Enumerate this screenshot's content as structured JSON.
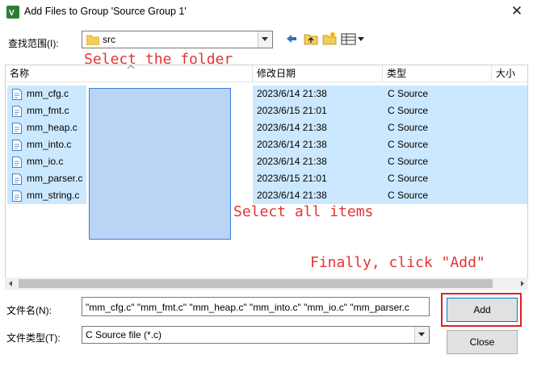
{
  "window": {
    "title": "Add Files to Group 'Source Group 1'"
  },
  "lookin": {
    "label": "查找范围(I):",
    "value": "src"
  },
  "columns": [
    {
      "label": "名称"
    },
    {
      "label": "修改日期"
    },
    {
      "label": "类型"
    },
    {
      "label": "大小"
    }
  ],
  "files": [
    {
      "name": "mm_cfg.c",
      "modified": "2023/6/14 21:38",
      "type": "C Source"
    },
    {
      "name": "mm_fmt.c",
      "modified": "2023/6/15 21:01",
      "type": "C Source"
    },
    {
      "name": "mm_heap.c",
      "modified": "2023/6/14 21:38",
      "type": "C Source"
    },
    {
      "name": "mm_into.c",
      "modified": "2023/6/14 21:38",
      "type": "C Source"
    },
    {
      "name": "mm_io.c",
      "modified": "2023/6/14 21:38",
      "type": "C Source"
    },
    {
      "name": "mm_parser.c",
      "modified": "2023/6/15 21:01",
      "type": "C Source"
    },
    {
      "name": "mm_string.c",
      "modified": "2023/6/14 21:38",
      "type": "C Source"
    }
  ],
  "filename": {
    "label": "文件名(N):",
    "value": "\"mm_cfg.c\" \"mm_fmt.c\" \"mm_heap.c\" \"mm_into.c\" \"mm_io.c\" \"mm_parser.c"
  },
  "filetype": {
    "label": "文件类型(T):",
    "value": "C Source file (*.c)"
  },
  "buttons": {
    "add": "Add",
    "close": "Close"
  },
  "annotations": {
    "step1": "Select the folder",
    "step2": "Select all items",
    "step3": "Finally, click \"Add\""
  },
  "colors": {
    "annotation": "#e53333",
    "selection": "#cce8ff",
    "accent": "#0078d7"
  }
}
